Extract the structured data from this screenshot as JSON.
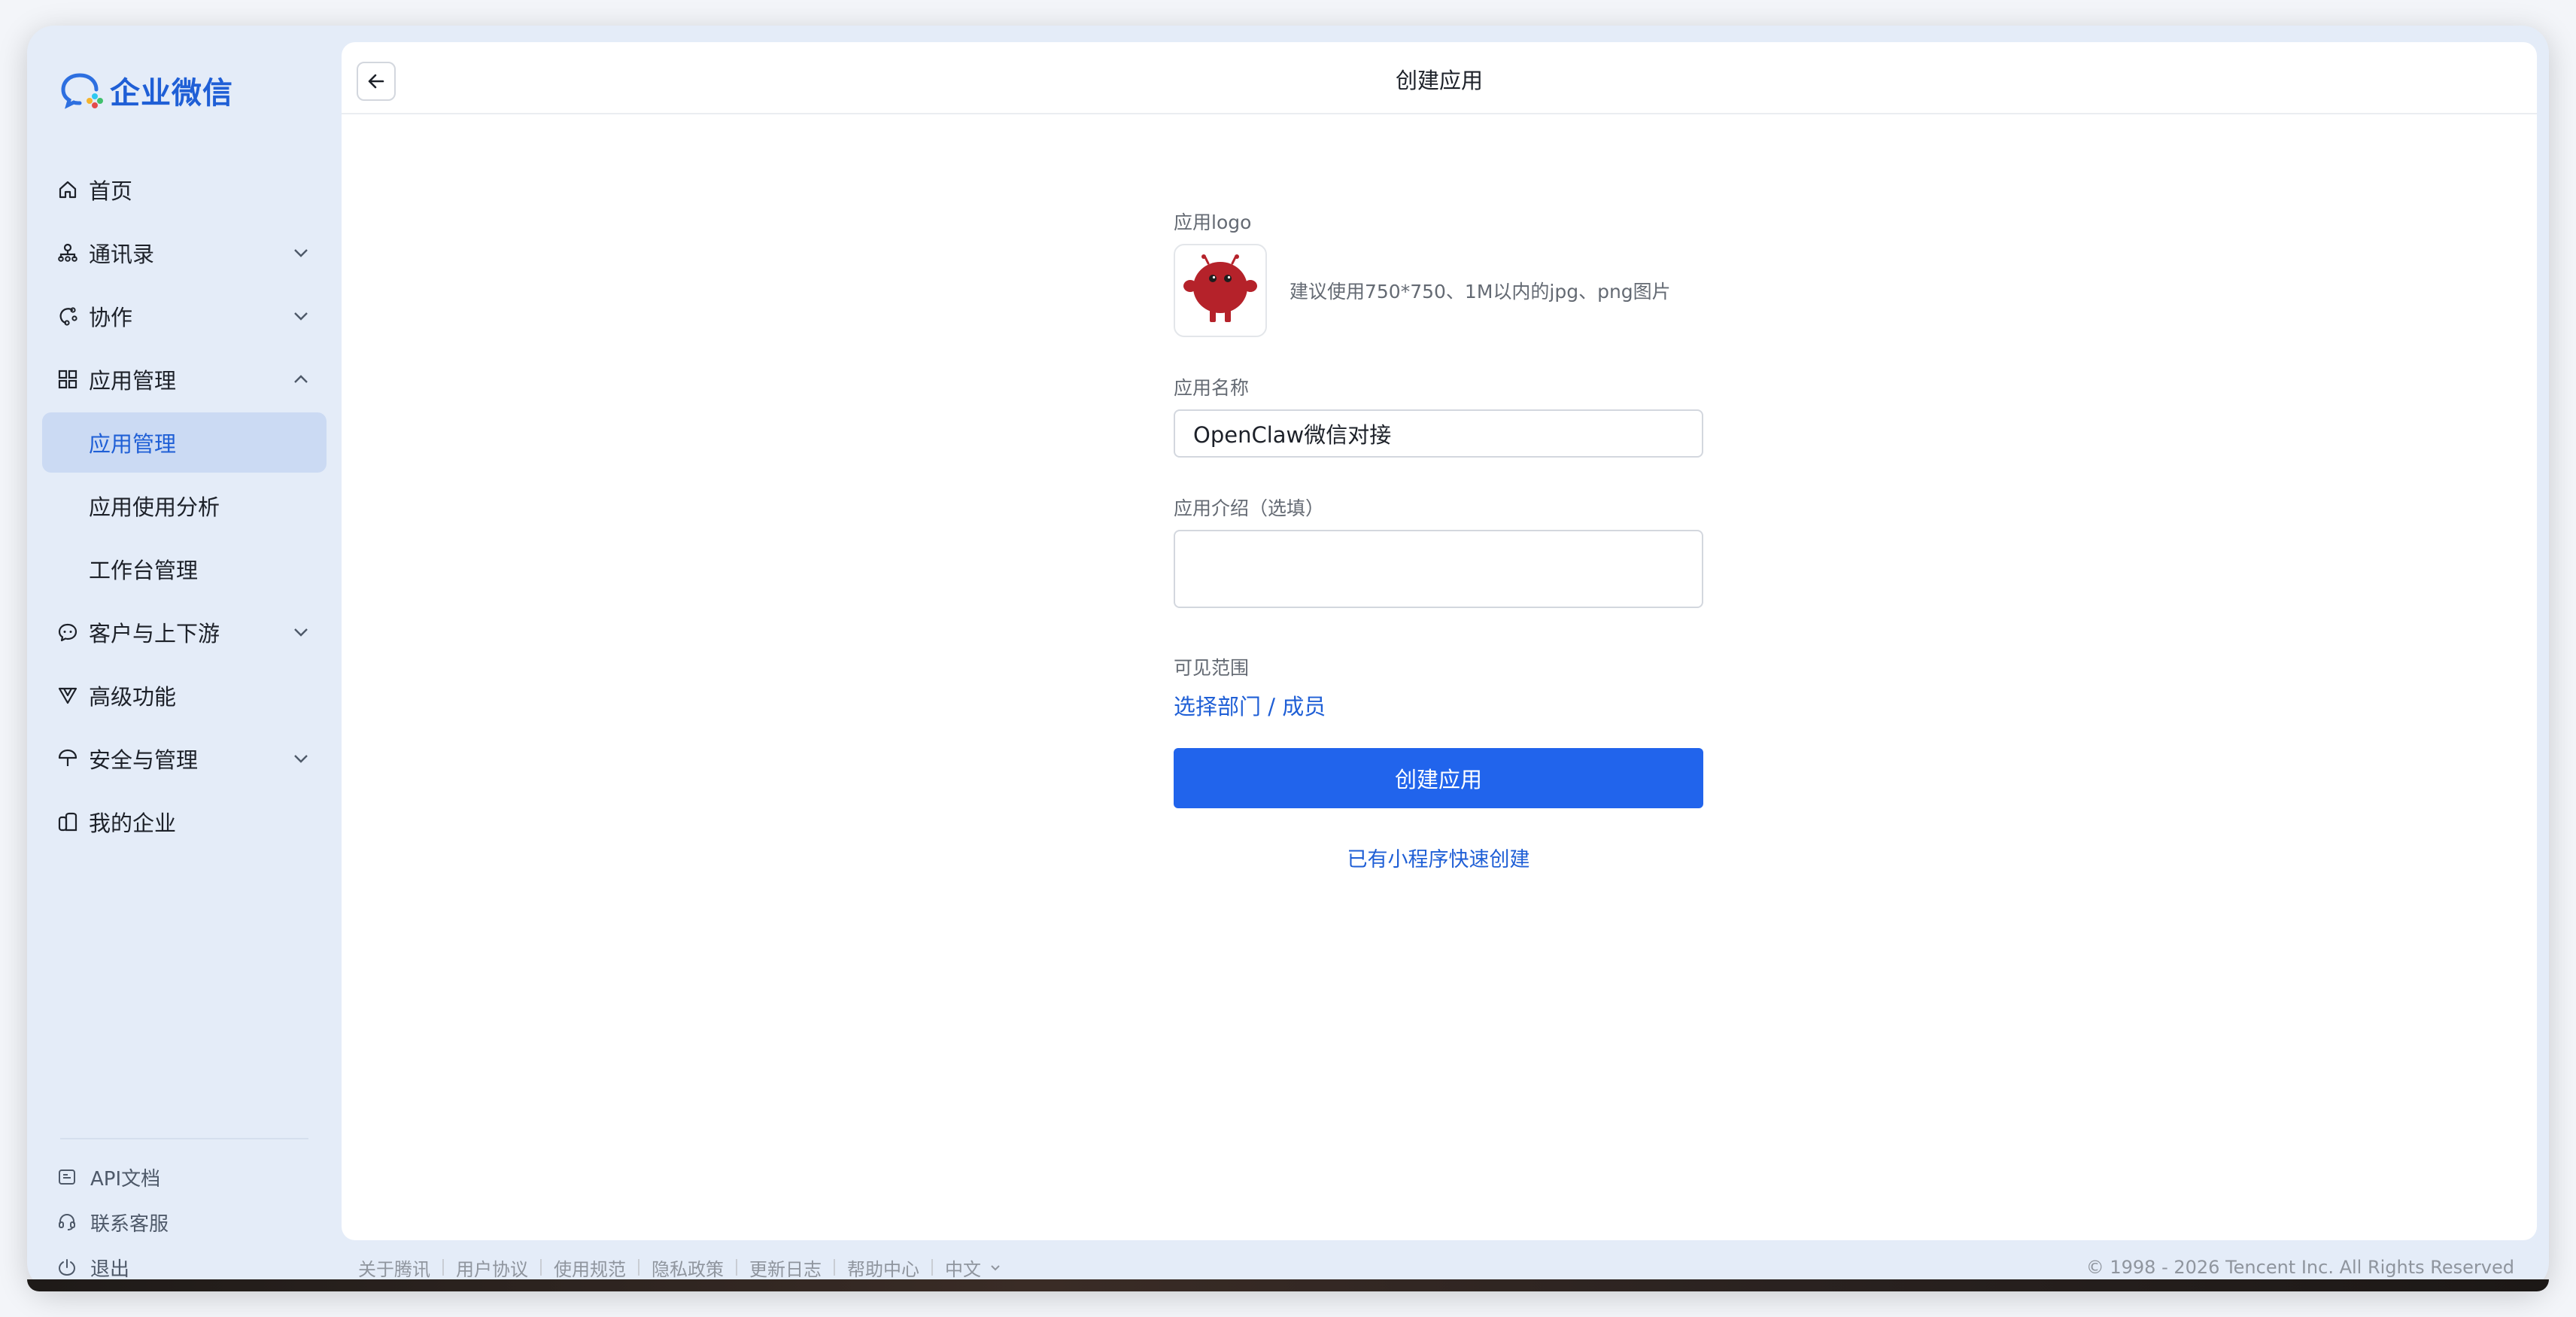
{
  "brand": {
    "name": "企业微信"
  },
  "sidebar": {
    "items": [
      {
        "label": "首页",
        "icon": "home-icon"
      },
      {
        "label": "通讯录",
        "icon": "org-chart-icon"
      },
      {
        "label": "协作",
        "icon": "collaboration-icon"
      },
      {
        "label": "应用管理",
        "icon": "apps-grid-icon"
      },
      {
        "label": "应用管理"
      },
      {
        "label": "应用使用分析"
      },
      {
        "label": "工作台管理"
      },
      {
        "label": "客户与上下游",
        "icon": "chat-bubble-icon"
      },
      {
        "label": "高级功能",
        "icon": "advanced-icon"
      },
      {
        "label": "安全与管理",
        "icon": "umbrella-icon"
      },
      {
        "label": "我的企业",
        "icon": "building-icon"
      }
    ],
    "footer": [
      {
        "label": "API文档",
        "icon": "document-icon"
      },
      {
        "label": "联系客服",
        "icon": "headset-icon"
      },
      {
        "label": "退出",
        "icon": "power-icon"
      }
    ]
  },
  "header": {
    "title": "创建应用"
  },
  "form": {
    "logo_label": "应用logo",
    "logo_hint": "建议使用750*750、1M以内的jpg、png图片",
    "name_label": "应用名称",
    "name_value": "OpenClaw微信对接",
    "intro_label": "应用介绍（选填）",
    "intro_value": "",
    "scope_label": "可见范围",
    "scope_link": "选择部门 / 成员",
    "submit_label": "创建应用",
    "quick_create_link": "已有小程序快速创建"
  },
  "footer": {
    "links": [
      "关于腾讯",
      "用户协议",
      "使用规范",
      "隐私政策",
      "更新日志",
      "帮助中心"
    ],
    "language": "中文",
    "copyright": "© 1998 - 2026 Tencent Inc. All Rights Reserved"
  },
  "colors": {
    "accent": "#2164ec",
    "sidebar_bg": "#e4ecf8",
    "active_bg": "#cbdaf3",
    "logo_red": "#b5222a"
  }
}
